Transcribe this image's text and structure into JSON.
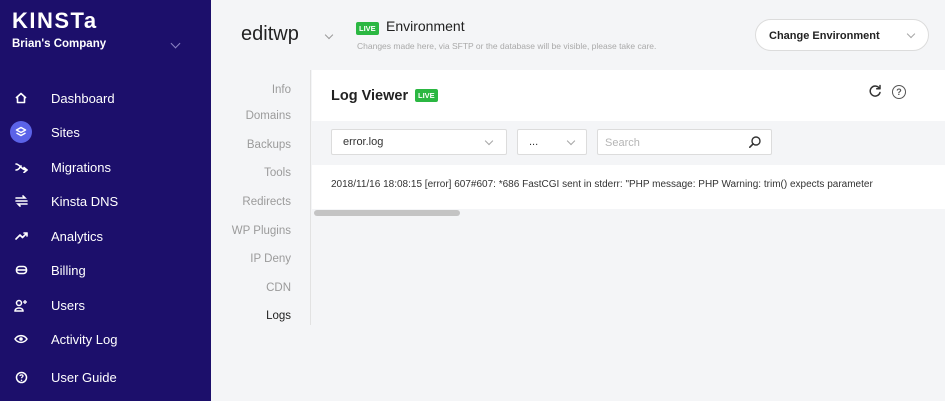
{
  "sidebar": {
    "logo": "KINSTa",
    "company": "Brian's Company",
    "items": [
      {
        "label": "Dashboard",
        "icon": "home-icon"
      },
      {
        "label": "Sites",
        "icon": "layers-icon"
      },
      {
        "label": "Migrations",
        "icon": "migrations-icon"
      },
      {
        "label": "Kinsta DNS",
        "icon": "dns-icon"
      },
      {
        "label": "Analytics",
        "icon": "analytics-icon"
      },
      {
        "label": "Billing",
        "icon": "billing-icon"
      },
      {
        "label": "Users",
        "icon": "users-icon"
      },
      {
        "label": "Activity Log",
        "icon": "eye-icon"
      },
      {
        "label": "User Guide",
        "icon": "question-icon"
      }
    ],
    "active_item": "Sites",
    "accent_color": "#5b63e8",
    "background_color": "#1c0f6b"
  },
  "header": {
    "site_name": "editwp",
    "live_badge": "LIVE",
    "env_title": "Environment",
    "env_description": "Changes made here, via SFTP or the database will be visible, please take care.",
    "change_env_label": "Change Environment"
  },
  "subnav": {
    "items": [
      "Info",
      "Domains",
      "Backups",
      "Tools",
      "Redirects",
      "WP Plugins",
      "IP Deny",
      "CDN",
      "Logs"
    ],
    "active": "Logs"
  },
  "panel": {
    "title": "Log Viewer",
    "live_badge": "LIVE",
    "file_select": "error.log",
    "lines_select": "...",
    "search_placeholder": "Search",
    "log_line": "2018/11/16 18:08:15 [error] 607#607: *686 FastCGI sent in stderr: \"PHP message: PHP Warning: trim() expects parameter",
    "live_color": "#2bb742"
  }
}
